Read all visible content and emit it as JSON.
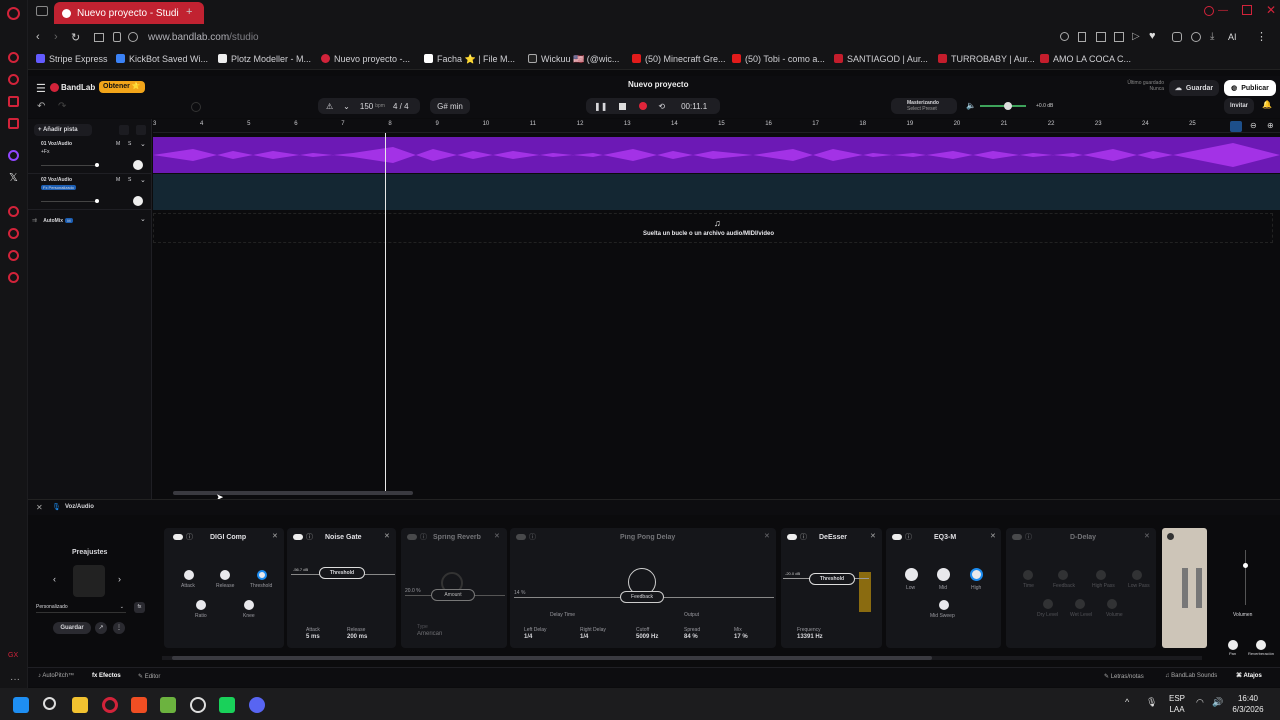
{
  "browser": {
    "tab_title": "Nuevo proyecto - Studi",
    "url_host": "www.bandlab.com",
    "url_path": "/studio",
    "bookmarks": [
      "Stripe Express",
      "KickBot Saved Wi...",
      "Plotz Modeller - M...",
      "Nuevo proyecto -...",
      "Facha ⭐ | File M...",
      "Wickuu 🇺🇸 (@wic...",
      "(50) Minecraft Gre...",
      "(50) Tobi - como a...",
      "SANTIAGOD | Aur...",
      "TURROBABY | Aur...",
      "AMO LA COCA C..."
    ],
    "ai_label": "AI"
  },
  "bandlab": {
    "brand": "BandLab",
    "obtener": "Obtener ⭐",
    "project_title": "Nuevo proyecto",
    "saved_label": "Último guardado",
    "saved_value": "Nunca",
    "guardar": "Guardar",
    "publicar": "Publicar",
    "invitar": "Invitar",
    "bpm": "150",
    "bpm_unit": "bpm",
    "time_sig": "4 / 4",
    "key": "G# min",
    "time": "00:11.1",
    "mastering": "Masterizando",
    "select_preset": "Select Preset",
    "master_db": "+0.0 dB",
    "add_track": "Añadir pista",
    "drop_text": "Suelta un bucle o un archivo audio/MIDI/video",
    "ruler": [
      "3",
      "4",
      "5",
      "6",
      "7",
      "8",
      "9",
      "10",
      "11",
      "12",
      "13",
      "14",
      "15",
      "16",
      "17",
      "18",
      "19",
      "20",
      "21",
      "22",
      "23",
      "24",
      "25"
    ],
    "tracks": [
      {
        "num": "01",
        "name": "Voz/Audio",
        "fx": "+Fx",
        "m": "M",
        "s": "S"
      },
      {
        "num": "02",
        "name": "Voz/Audio",
        "fx": "Fx Personalizado",
        "m": "M",
        "s": "S"
      }
    ],
    "automix": "AutoMix",
    "automix_badge": "M"
  },
  "fx": {
    "track": "Voz/Audio",
    "presets_title": "Preajustes",
    "preset_value": "Personalizado",
    "save": "Guardar",
    "plugins": [
      {
        "name": "DIGI Comp",
        "labels": [
          "Attack",
          "Release",
          "Threshold",
          "Ratio",
          "Knee"
        ]
      },
      {
        "name": "Noise Gate",
        "labels": [
          "Threshold",
          "Attack",
          "Release"
        ],
        "values": [
          "5 ms",
          "200 ms"
        ],
        "db": "-56.7 dB"
      },
      {
        "name": "Spring Reverb",
        "labels": [
          "Amount",
          "Type"
        ],
        "values": [
          "American"
        ],
        "pct": "20.0 %"
      },
      {
        "name": "Ping Pong Delay",
        "labels": [
          "Feedback",
          "Delay Time",
          "Left Delay",
          "Right Delay",
          "Cutoff",
          "Output",
          "Spread",
          "Mix"
        ],
        "values": [
          "1/4",
          "1/4",
          "5009 Hz",
          "84 %",
          "17 %"
        ],
        "pct": "14 %"
      },
      {
        "name": "DeEsser",
        "labels": [
          "Threshold",
          "Frequency"
        ],
        "values": [
          "13391 Hz"
        ],
        "db": "-20.0 dB"
      },
      {
        "name": "EQ3-M",
        "labels": [
          "Low",
          "Mid",
          "High",
          "Mid Sweep"
        ]
      },
      {
        "name": "D-Delay",
        "labels": [
          "Time",
          "Feedback",
          "High Pass",
          "Low Pass",
          "Dry Level",
          "Wet Level",
          "Volume"
        ]
      }
    ],
    "volume": "Volumen",
    "pan": "Pan",
    "reverb": "Reverberación"
  },
  "bottom": {
    "autopitch": "AutoPitch™",
    "efectos": "Efectos",
    "editor": "Editor",
    "letras": "Letras/notas",
    "sounds": "BandLab Sounds",
    "atajos": "Atajos"
  },
  "taskbar": {
    "lang": "ESP",
    "lang2": "LAA",
    "time": "16:40",
    "date": "6/3/2026"
  }
}
